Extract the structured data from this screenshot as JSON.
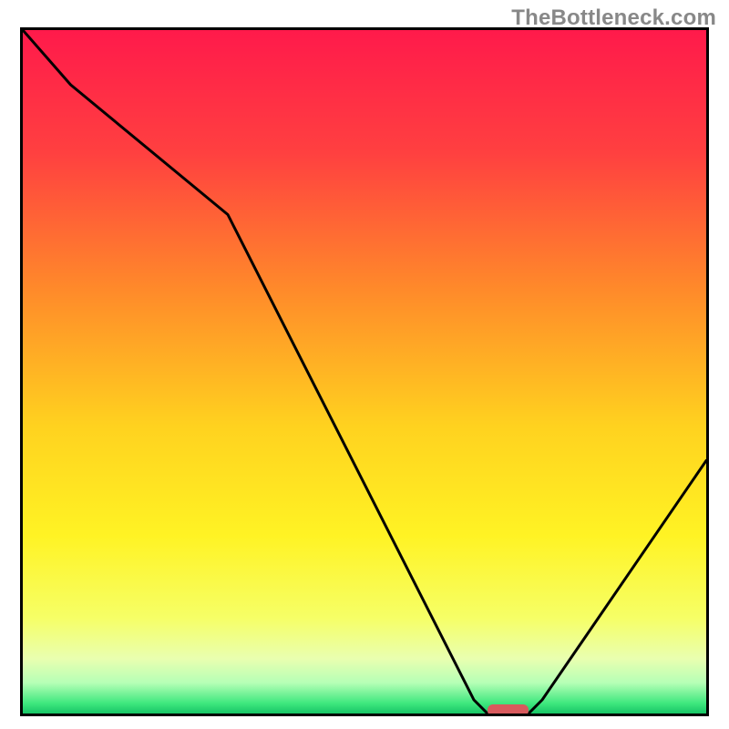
{
  "watermark": "TheBottleneck.com",
  "chart_data": {
    "type": "line",
    "title": "",
    "xlabel": "",
    "ylabel": "",
    "xlim": [
      0,
      100
    ],
    "ylim": [
      0,
      100
    ],
    "x": [
      0,
      7,
      30,
      66,
      68,
      74,
      76,
      100
    ],
    "values": [
      100,
      92,
      73,
      2,
      0,
      0,
      2,
      37
    ],
    "marker": {
      "x_start": 68,
      "x_end": 74,
      "y": 0,
      "color": "#d85a5d"
    },
    "background_gradient": [
      {
        "offset": 0.0,
        "color": "#ff1a4b"
      },
      {
        "offset": 0.18,
        "color": "#ff4040"
      },
      {
        "offset": 0.38,
        "color": "#ff8a2a"
      },
      {
        "offset": 0.58,
        "color": "#ffd21f"
      },
      {
        "offset": 0.74,
        "color": "#fff324"
      },
      {
        "offset": 0.86,
        "color": "#f6ff66"
      },
      {
        "offset": 0.92,
        "color": "#e9ffb0"
      },
      {
        "offset": 0.955,
        "color": "#b6ffb6"
      },
      {
        "offset": 0.985,
        "color": "#3fe87e"
      },
      {
        "offset": 1.0,
        "color": "#17c566"
      }
    ]
  }
}
